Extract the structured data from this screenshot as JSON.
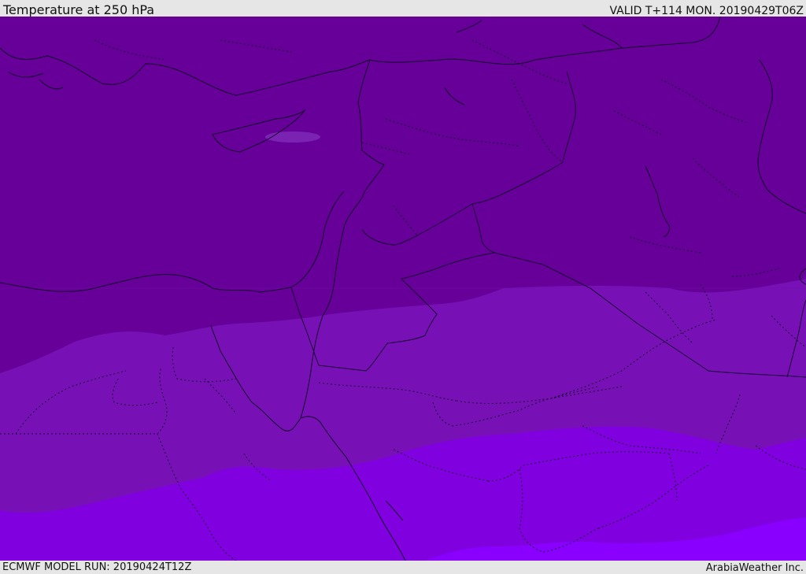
{
  "header": {
    "title": "Temperature at 250 hPa",
    "valid": "VALID T+114 MON. 20190429T06Z"
  },
  "footer": {
    "model_run": "ECMWF MODEL RUN: 20190424T12Z",
    "credit": "ArabiaWeather Inc."
  },
  "map": {
    "region": "Eastern Mediterranean, Levant, Egypt, Arabian Peninsula",
    "fill_colors": {
      "band_1": "#660099",
      "band_2": "#7711b5",
      "band_3": "#8000df",
      "band_4": "#8a00ff",
      "highlight": "#8a3fc6"
    },
    "line_colors": {
      "coastline": "#14002a",
      "border": "#1a0033"
    }
  }
}
